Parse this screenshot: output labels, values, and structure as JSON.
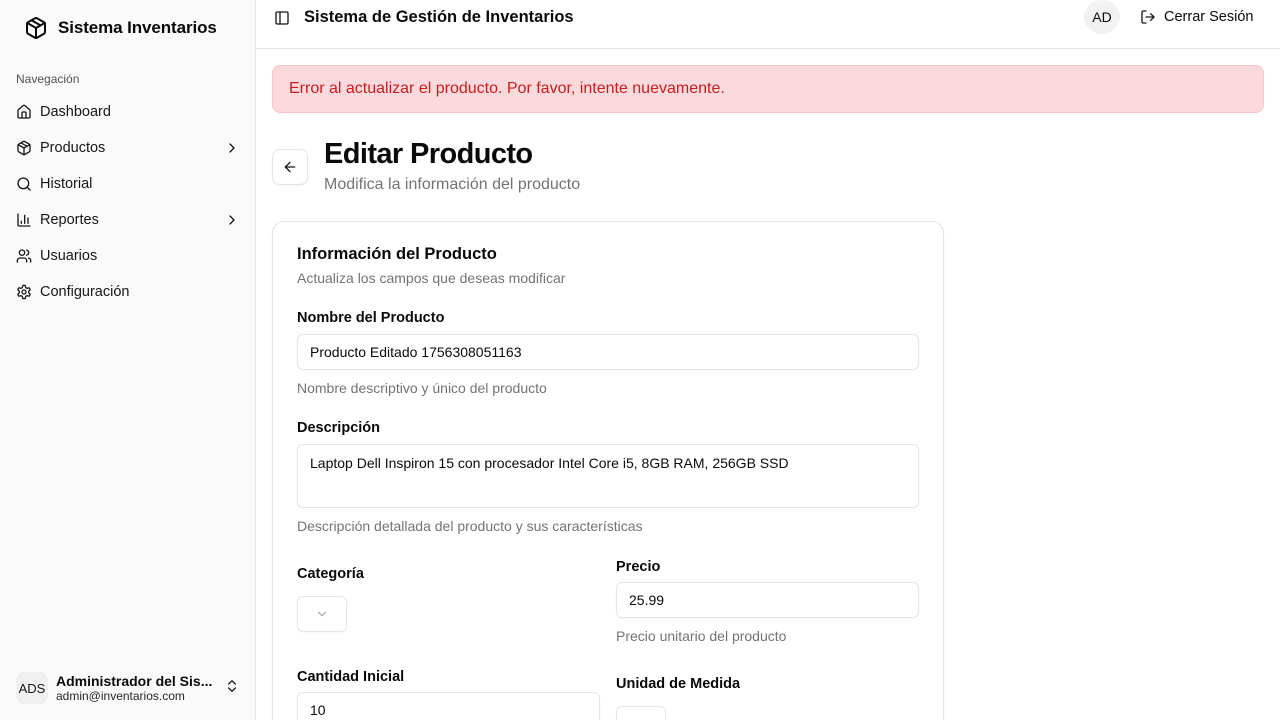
{
  "brand": {
    "name": "Sistema Inventarios"
  },
  "sidebar": {
    "group_label": "Navegación",
    "items": [
      {
        "label": "Dashboard",
        "icon": "home-icon"
      },
      {
        "label": "Productos",
        "icon": "package-icon",
        "has_submenu": true
      },
      {
        "label": "Historial",
        "icon": "search-icon"
      },
      {
        "label": "Reportes",
        "icon": "bar-chart-icon",
        "has_submenu": true
      },
      {
        "label": "Usuarios",
        "icon": "users-icon"
      },
      {
        "label": "Configuración",
        "icon": "gear-icon"
      }
    ],
    "user": {
      "initials": "ADS",
      "name": "Administrador del Sis...",
      "email": "admin@inventarios.com"
    }
  },
  "header": {
    "title": "Sistema de Gestión de Inventarios",
    "avatar_initials": "AD",
    "logout_label": "Cerrar Sesión"
  },
  "alert": {
    "message": "Error al actualizar el producto. Por favor, intente nuevamente.",
    "color": "#c81e1e",
    "background": "#fcd9dc"
  },
  "page": {
    "title": "Editar Producto",
    "subtitle": "Modifica la información del producto"
  },
  "form": {
    "card_title": "Información del Producto",
    "card_description": "Actualiza los campos que deseas modificar",
    "name": {
      "label": "Nombre del Producto",
      "value": "Producto Editado 1756308051163",
      "help": "Nombre descriptivo y único del producto"
    },
    "description": {
      "label": "Descripción",
      "value": "Laptop Dell Inspiron 15 con procesador Intel Core i5, 8GB RAM, 256GB SSD",
      "help": "Descripción detallada del producto y sus características"
    },
    "category": {
      "label": "Categoría",
      "value": ""
    },
    "price": {
      "label": "Precio",
      "value": "25.99",
      "help": "Precio unitario del producto"
    },
    "initial_quantity": {
      "label": "Cantidad Inicial",
      "value": "10"
    },
    "unit": {
      "label": "Unidad de Medida",
      "value": ""
    }
  }
}
